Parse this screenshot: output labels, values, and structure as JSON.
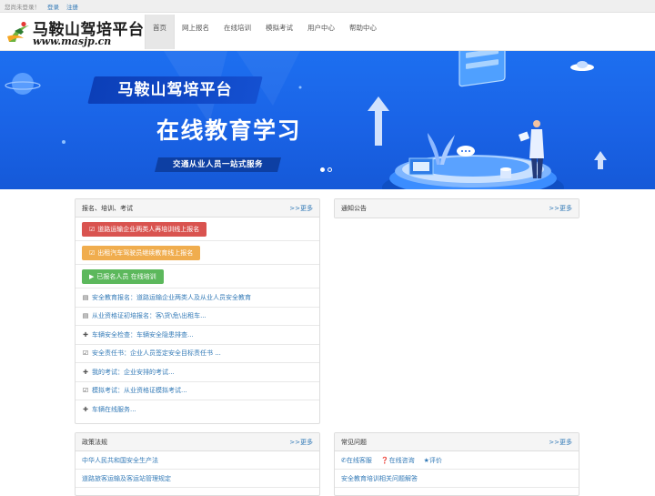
{
  "topbar": {
    "status": "您尚未登录！",
    "login": "登录",
    "register": "注册"
  },
  "logo": {
    "title": "马鞍山驾培平台",
    "url": "www.masjp.cn"
  },
  "nav": [
    {
      "label": "首页",
      "active": true
    },
    {
      "label": "网上报名"
    },
    {
      "label": "在线培训"
    },
    {
      "label": "模拟考试"
    },
    {
      "label": "用户中心"
    },
    {
      "label": "帮助中心"
    }
  ],
  "banner": {
    "ribbon": "马鞍山驾培平台",
    "headline": "在线教育学习",
    "tagline": "交通从业人员一站式服务"
  },
  "panels": {
    "reg": {
      "title": "报名、培训、考试",
      "more": ">>更多",
      "buttons": [
        {
          "label": "道路运输企业两类人再培训线上报名",
          "icon": "check-square-icon"
        },
        {
          "label": "出租汽车驾驶员继续教育线上报名",
          "icon": "check-square-icon"
        },
        {
          "label": "已报名人员 在线培训",
          "icon": "play-icon"
        }
      ],
      "links": [
        {
          "icon": "list-icon",
          "label": "安全教育报名：道路运输企业两类人及从业人员安全教育"
        },
        {
          "icon": "list-icon",
          "label": "从业资格证初培报名：客\\货\\危\\出租车..."
        },
        {
          "icon": "plus-icon",
          "label": "车辆安全检查：车辆安全隐患排查..."
        },
        {
          "icon": "check-square-icon",
          "label": "安全责任书：企业人员签定安全目标责任书 ..."
        },
        {
          "icon": "plus-icon",
          "label": "我的考试：企业安排的考试..."
        },
        {
          "icon": "check-square-icon",
          "label": "模拟考试：从业资格证模拟考试..."
        },
        {
          "icon": "plus-icon",
          "label": "车辆在线服务..."
        }
      ]
    },
    "notice": {
      "title": "通知公告",
      "more": ">>更多"
    },
    "law": {
      "title": "政策法规",
      "more": ">>更多",
      "items": [
        "中华人民共和国安全生产法",
        "道路旅客运输及客运站管理规定"
      ]
    },
    "faq": {
      "title": "常见问题",
      "more": ">>更多",
      "tools": [
        {
          "icon": "phone-icon",
          "label": "在线客服"
        },
        {
          "icon": "question-icon",
          "label": "在线咨询"
        },
        {
          "icon": "star-icon",
          "label": "评价"
        }
      ],
      "items": [
        "安全教育培训相关问题解答"
      ]
    }
  },
  "colors": {
    "banner": "#1a63e6",
    "red": "#d9534f",
    "orange": "#f0ad4e",
    "green": "#5cb85c",
    "link": "#337ab7"
  }
}
